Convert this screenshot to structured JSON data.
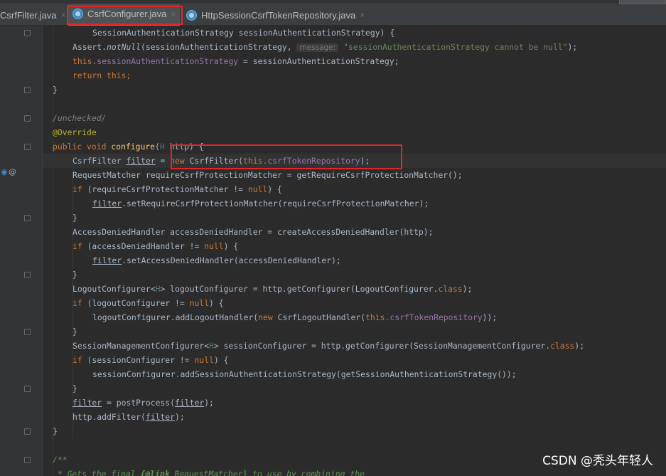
{
  "tabs": [
    {
      "label": "CsrfFilter.java",
      "close": "×"
    },
    {
      "label": "CsrfConfigurer.java",
      "close": "×"
    },
    {
      "label": "HttpSessionCsrfTokenRepository.java",
      "close": "×"
    }
  ],
  "gutter_marks": {
    "override_marker": "@"
  },
  "code": {
    "l1_text": "SessionAuthenticationStrategy sessionAuthenticationStrategy) {",
    "l2_obj": "Assert.",
    "l2_method": "notNull",
    "l2_args": "(sessionAuthenticationStrategy, ",
    "l2_hint": "message:",
    "l2_string": "\"sessionAuthenticationStrategy cannot be null\"",
    "l2_end": ");",
    "l3_this": "this",
    "l3_field": ".sessionAuthenticationStrategy",
    "l3_rest": " = sessionAuthenticationStrategy;",
    "l4_return": "return",
    "l4_this": " this",
    "l4_end": ";",
    "l5": "}",
    "l7_comment": "/unchecked/",
    "l8_annotation": "@Override",
    "l9_kw": "public void ",
    "l9_method": "configure",
    "l9_paren": "(",
    "l9_type": "H",
    "l9_param": " http) {",
    "l10_type": "CsrfFilter ",
    "l10_var": "filter",
    "l10_eq": " = ",
    "l10_new": "new",
    "l10_ctor": " CsrfFilter(",
    "l10_this": "this",
    "l10_field": ".csrfTokenRepository",
    "l10_end": ");",
    "l11": "RequestMatcher requireCsrfProtectionMatcher = getRequireCsrfProtectionMatcher();",
    "l12_if": "if",
    "l12_mid": " (requireCsrfProtectionMatcher != ",
    "l12_null": "null",
    "l12_end": ") {",
    "l13_var": "filter",
    "l13_rest": ".setRequireCsrfProtectionMatcher(requireCsrfProtectionMatcher);",
    "l14": "}",
    "l15": "AccessDeniedHandler accessDeniedHandler = createAccessDeniedHandler(http);",
    "l16_if": "if",
    "l16_mid": " (accessDeniedHandler != ",
    "l16_null": "null",
    "l16_end": ") {",
    "l17_var": "filter",
    "l17_rest": ".setAccessDeniedHandler(accessDeniedHandler);",
    "l18": "}",
    "l19_a": "LogoutConfigurer<",
    "l19_gen": "H",
    "l19_b": "> logoutConfigurer = http.getConfigurer(LogoutConfigurer.",
    "l19_class": "class",
    "l19_end": ");",
    "l20_if": "if",
    "l20_mid": " (logoutConfigurer != ",
    "l20_null": "null",
    "l20_end": ") {",
    "l21_a": "logoutConfigurer.addLogoutHandler(",
    "l21_new": "new",
    "l21_b": " CsrfLogoutHandler(",
    "l21_this": "this",
    "l21_field": ".csrfTokenRepository",
    "l21_end": "));",
    "l22": "}",
    "l23_a": "SessionManagementConfigurer<",
    "l23_gen": "H",
    "l23_b": "> sessionConfigurer = http.getConfigurer(SessionManagementConfigurer.",
    "l23_class": "class",
    "l23_end": ");",
    "l24_if": "if",
    "l24_mid": " (sessionConfigurer != ",
    "l24_null": "null",
    "l24_end": ") {",
    "l25": "sessionConfigurer.addSessionAuthenticationStrategy(getSessionAuthenticationStrategy());",
    "l26": "}",
    "l27_var": "filter",
    "l27_mid": " = postProcess(",
    "l27_var2": "filter",
    "l27_end": ");",
    "l28_a": "http.addFilter(",
    "l28_var": "filter",
    "l28_end": ");",
    "l29": "}",
    "l31": "/**",
    "l32_a": " * Gets the final ",
    "l32_tag": "{@link",
    "l32_b": " RequestMatcher} to use by combining the"
  },
  "watermark": "CSDN @秃头年轻人",
  "colors": {
    "background": "#2b2b2b",
    "keyword": "#cc7832",
    "field": "#9876aa",
    "string": "#6a8759",
    "method": "#ffc66d",
    "annotation": "#bbb529",
    "highlight_box": "#e0262b"
  }
}
